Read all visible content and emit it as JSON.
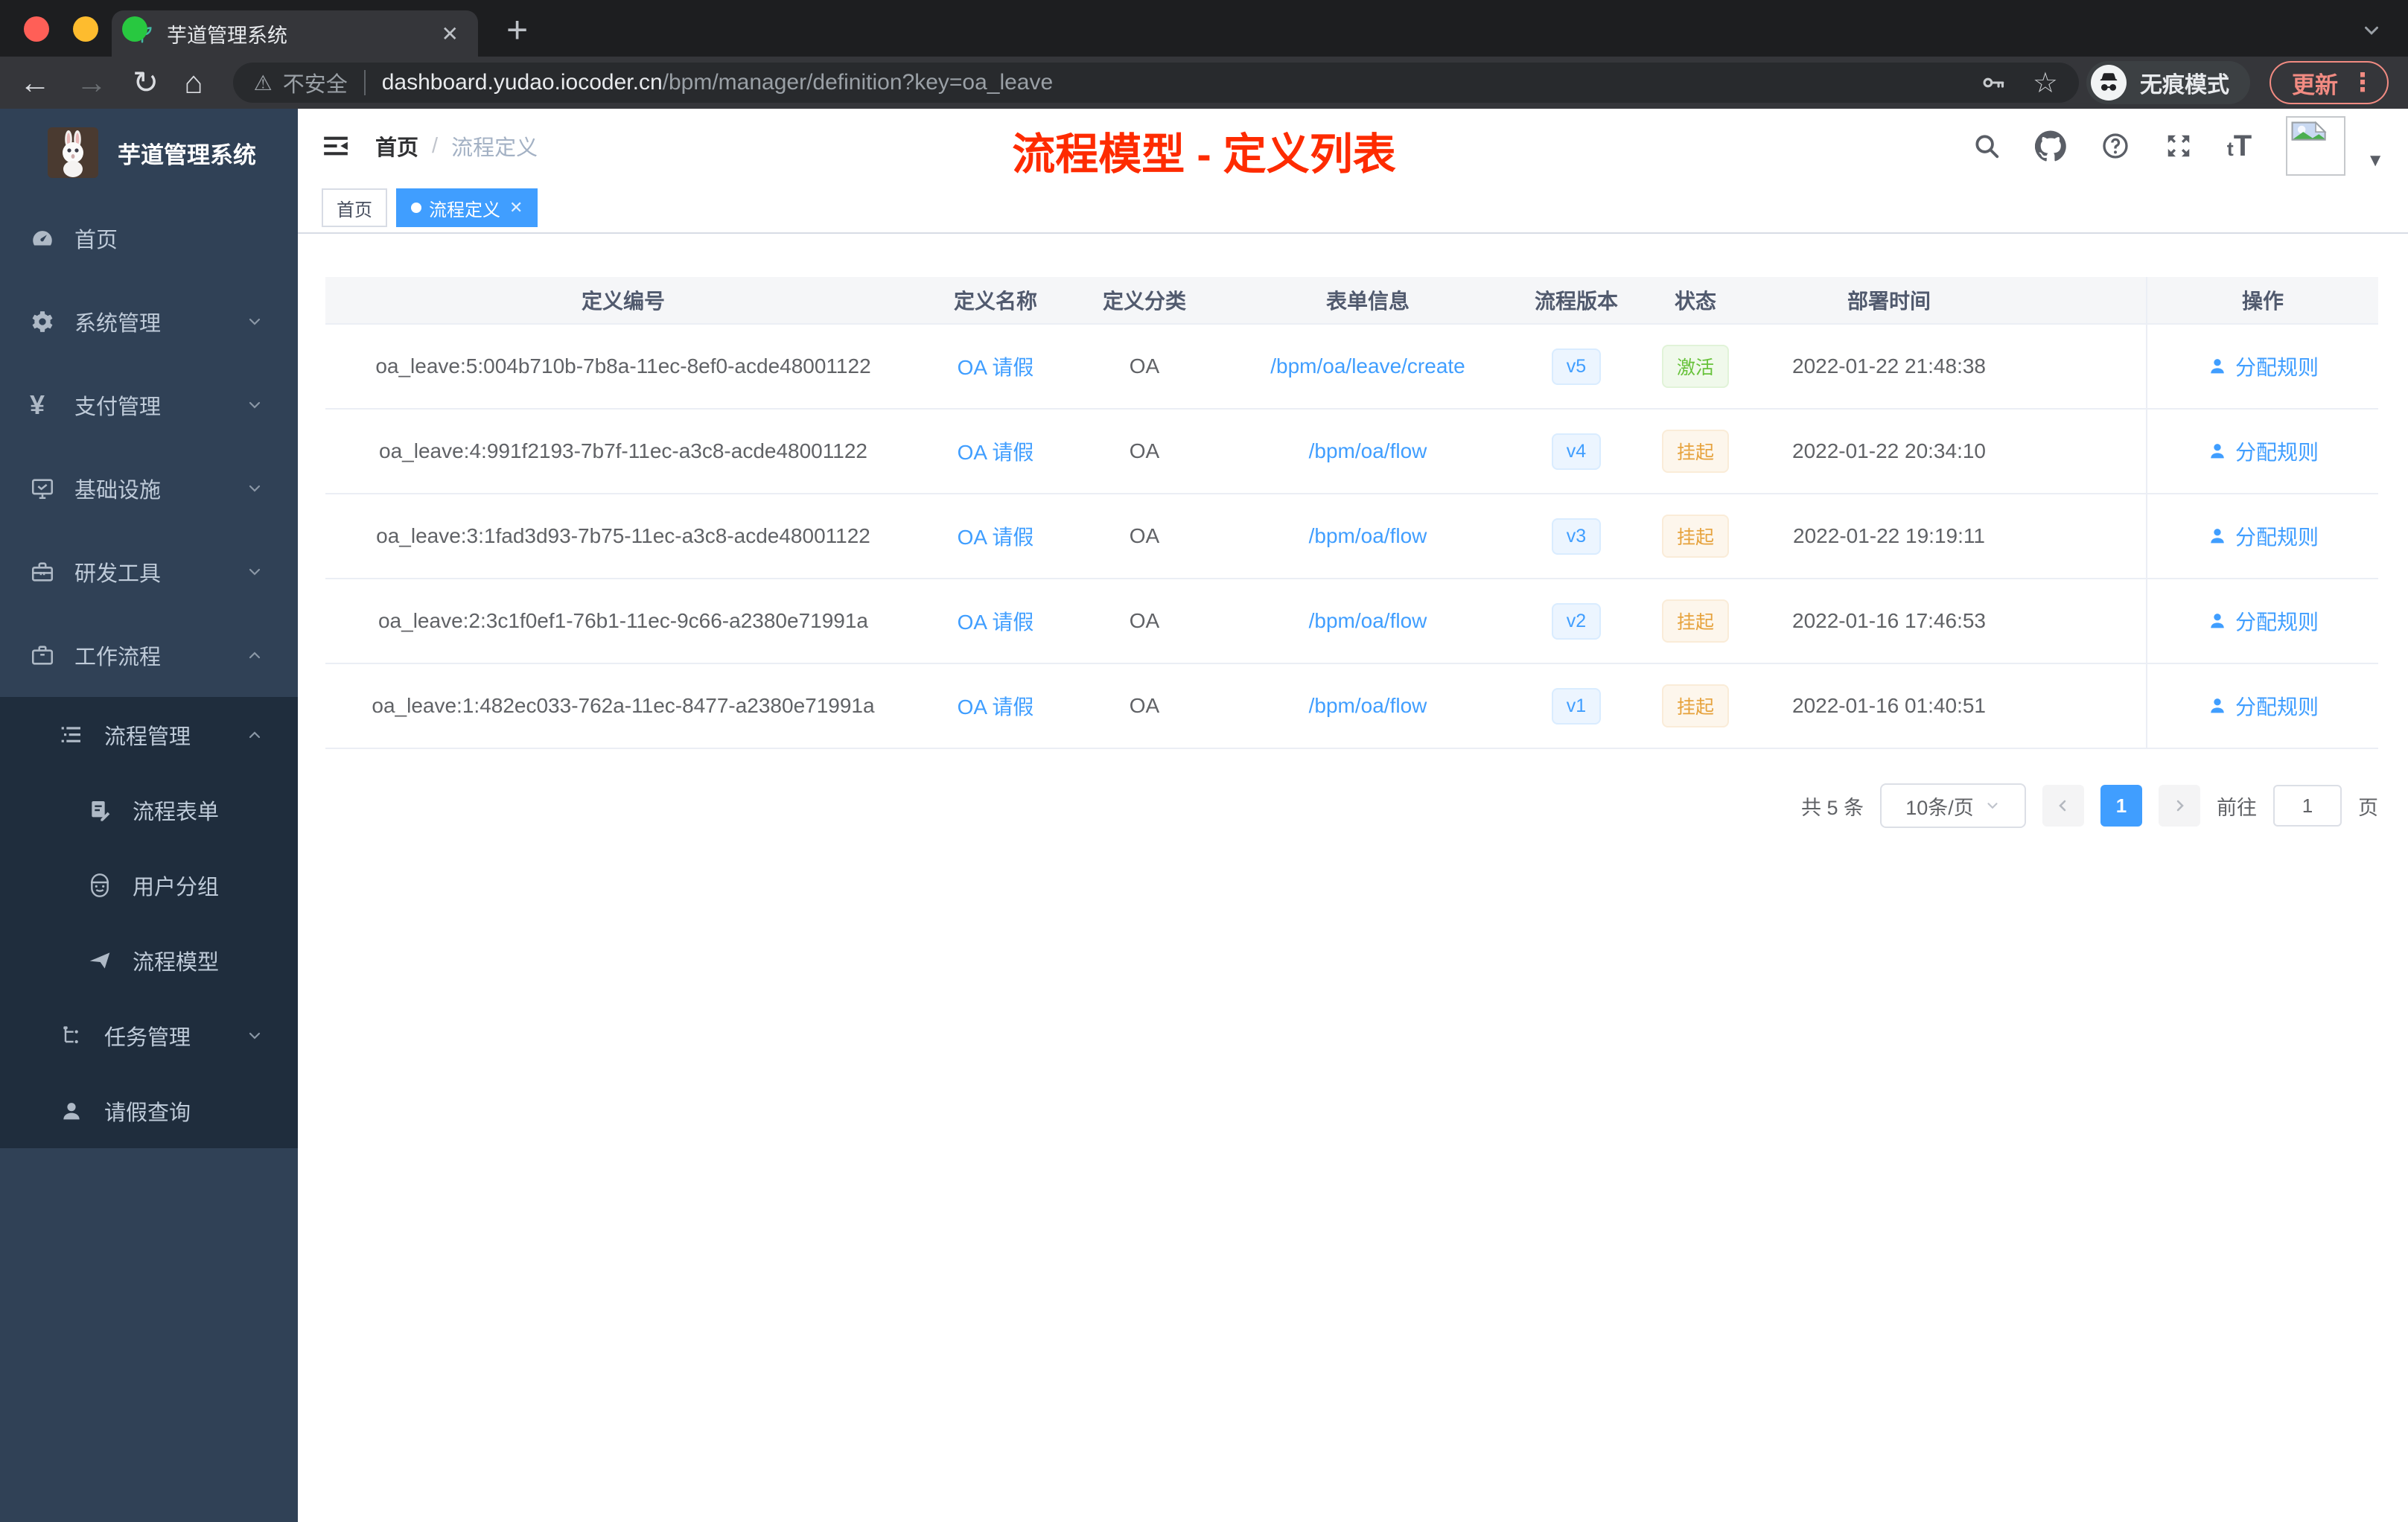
{
  "browser": {
    "tab_title": "芋道管理系统",
    "close_tab": "✕",
    "new_tab": "+",
    "not_secure": "不安全",
    "url_host": "dashboard.yudao.iocoder.cn",
    "url_path": "/bpm/manager/definition?key=oa_leave",
    "incognito_label": "无痕模式",
    "update_label": "更新"
  },
  "sidebar": {
    "logo_title": "芋道管理系统",
    "items": [
      {
        "label": "首页",
        "expandable": false
      },
      {
        "label": "系统管理",
        "expandable": true,
        "state": "collapsed"
      },
      {
        "label": "支付管理",
        "expandable": true,
        "state": "collapsed"
      },
      {
        "label": "基础设施",
        "expandable": true,
        "state": "collapsed"
      },
      {
        "label": "研发工具",
        "expandable": true,
        "state": "collapsed"
      },
      {
        "label": "工作流程",
        "expandable": true,
        "state": "expanded"
      },
      {
        "label": "流程管理",
        "expandable": true,
        "state": "expanded"
      },
      {
        "label": "流程表单",
        "expandable": false
      },
      {
        "label": "用户分组",
        "expandable": false
      },
      {
        "label": "流程模型",
        "expandable": false
      },
      {
        "label": "任务管理",
        "expandable": true,
        "state": "collapsed"
      },
      {
        "label": "请假查询",
        "expandable": false
      }
    ]
  },
  "navbar": {
    "breadcrumb": {
      "home": "首页",
      "separator": "/",
      "current": "流程定义"
    },
    "overlay_title": "流程模型 - 定义列表",
    "font_icon_small": "t",
    "font_icon_large": "T"
  },
  "tags_view": {
    "tags": [
      {
        "label": "首页",
        "active": false
      },
      {
        "label": "流程定义",
        "active": true
      }
    ]
  },
  "table": {
    "columns": [
      "定义编号",
      "定义名称",
      "定义分类",
      "表单信息",
      "流程版本",
      "状态",
      "部署时间",
      "操作"
    ],
    "rows": [
      {
        "id": "oa_leave:5:004b710b-7b8a-11ec-8ef0-acde48001122",
        "name": "OA 请假",
        "category": "OA",
        "form": "/bpm/oa/leave/create",
        "version": "v5",
        "status": "激活",
        "deploy_time": "2022-01-22 21:48:38",
        "action": "分配规则"
      },
      {
        "id": "oa_leave:4:991f2193-7b7f-11ec-a3c8-acde48001122",
        "name": "OA 请假",
        "category": "OA",
        "form": "/bpm/oa/flow",
        "version": "v4",
        "status": "挂起",
        "deploy_time": "2022-01-22 20:34:10",
        "action": "分配规则"
      },
      {
        "id": "oa_leave:3:1fad3d93-7b75-11ec-a3c8-acde48001122",
        "name": "OA 请假",
        "category": "OA",
        "form": "/bpm/oa/flow",
        "version": "v3",
        "status": "挂起",
        "deploy_time": "2022-01-22 19:19:11",
        "action": "分配规则"
      },
      {
        "id": "oa_leave:2:3c1f0ef1-76b1-11ec-9c66-a2380e71991a",
        "name": "OA 请假",
        "category": "OA",
        "form": "/bpm/oa/flow",
        "version": "v2",
        "status": "挂起",
        "deploy_time": "2022-01-16 17:46:53",
        "action": "分配规则"
      },
      {
        "id": "oa_leave:1:482ec033-762a-11ec-8477-a2380e71991a",
        "name": "OA 请假",
        "category": "OA",
        "form": "/bpm/oa/flow",
        "version": "v1",
        "status": "挂起",
        "deploy_time": "2022-01-16 01:40:51",
        "action": "分配规则"
      }
    ]
  },
  "pagination": {
    "total": "共 5 条",
    "page_size": "10条/页",
    "current_page": "1",
    "goto_label": "前往",
    "goto_value": "1",
    "unit": "页"
  },
  "colors": {
    "accent": "#409eff",
    "overlay_title": "#fe2b00",
    "status_active": "#67c23a",
    "status_suspended": "#e6a23c",
    "sidebar_bg": "#304156",
    "submenu_bg": "#1f2d3d"
  }
}
